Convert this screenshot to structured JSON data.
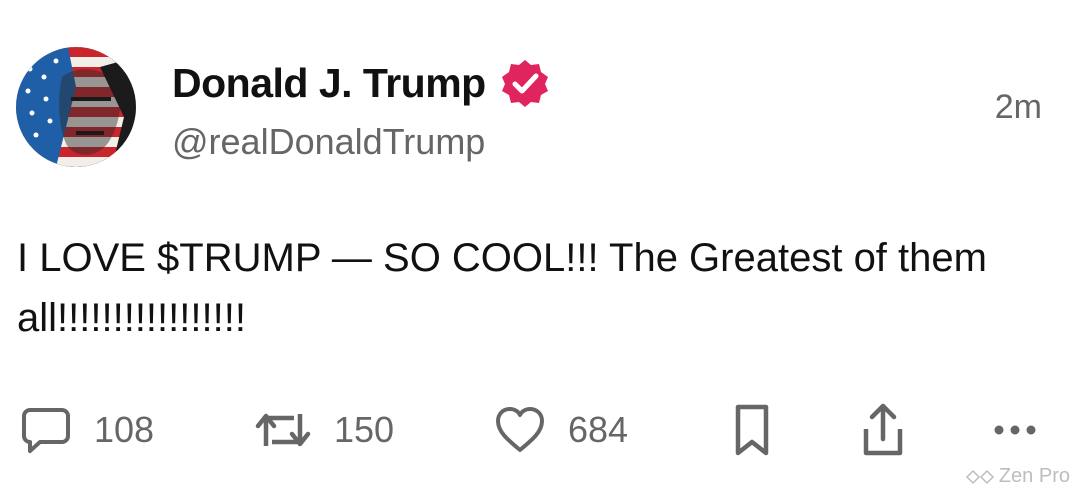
{
  "post": {
    "author": {
      "display_name": "Donald J. Trump",
      "handle": "@realDonaldTrump",
      "verified": true,
      "verified_badge_color": "#e0245e",
      "avatar_icon": "flag-portrait-avatar"
    },
    "timestamp": "2m",
    "text": "I LOVE $TRUMP — SO COOL!!! The Greatest of them all!!!!!!!!!!!!!!!!!"
  },
  "actions": {
    "reply": {
      "icon": "comment-icon",
      "count": "108"
    },
    "repost": {
      "icon": "repost-icon",
      "count": "150"
    },
    "like": {
      "icon": "heart-icon",
      "count": "684"
    },
    "bookmark": {
      "icon": "bookmark-icon"
    },
    "share": {
      "icon": "share-icon"
    },
    "more": {
      "icon": "more-icon"
    }
  },
  "watermark": {
    "text": "Zen Pro",
    "icon": "watermark-logo-icon"
  },
  "colors": {
    "text": "#111111",
    "secondary": "#666666",
    "background": "#ffffff"
  }
}
